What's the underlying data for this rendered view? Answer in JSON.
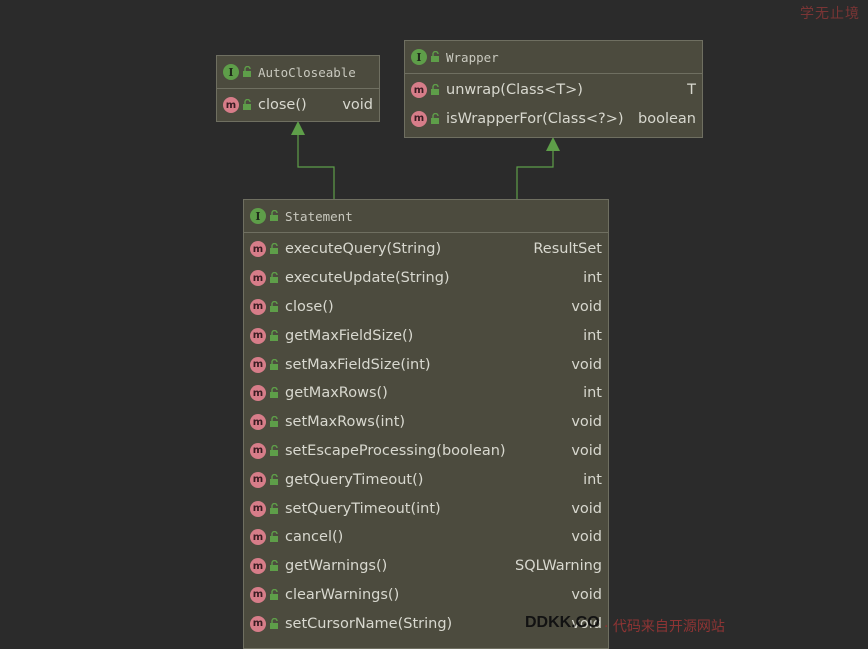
{
  "icons": {
    "interface": "I",
    "method": "m"
  },
  "colors": {
    "background": "#2b2b2b",
    "box": "#4c4b3e",
    "interface_icon": "#5e9e49",
    "method_icon": "#d77d89",
    "arrow": "#5e9e49"
  },
  "autocloseable": {
    "title": "AutoCloseable",
    "methods": [
      {
        "name": "close()",
        "type": "void"
      }
    ]
  },
  "wrapper": {
    "title": "Wrapper",
    "methods": [
      {
        "name": "unwrap(Class<T>)",
        "type": "T"
      },
      {
        "name": "isWrapperFor(Class<?>)",
        "type": "boolean"
      }
    ]
  },
  "statement": {
    "title": "Statement",
    "methods": [
      {
        "name": "executeQuery(String)",
        "type": "ResultSet"
      },
      {
        "name": "executeUpdate(String)",
        "type": "int"
      },
      {
        "name": "close()",
        "type": "void"
      },
      {
        "name": "getMaxFieldSize()",
        "type": "int"
      },
      {
        "name": "setMaxFieldSize(int)",
        "type": "void"
      },
      {
        "name": "getMaxRows()",
        "type": "int"
      },
      {
        "name": "setMaxRows(int)",
        "type": "void"
      },
      {
        "name": "setEscapeProcessing(boolean)",
        "type": "void"
      },
      {
        "name": "getQueryTimeout()",
        "type": "int"
      },
      {
        "name": "setQueryTimeout(int)",
        "type": "void"
      },
      {
        "name": "cancel()",
        "type": "void"
      },
      {
        "name": "getWarnings()",
        "type": "SQLWarning"
      },
      {
        "name": "clearWarnings()",
        "type": "void"
      },
      {
        "name": "setCursorName(String)",
        "type": "void"
      }
    ]
  },
  "watermarks": {
    "top_right": "学无止境",
    "bottom_logo": "DDKK.CO",
    "bottom_text": "· 代码来自开源网站"
  }
}
